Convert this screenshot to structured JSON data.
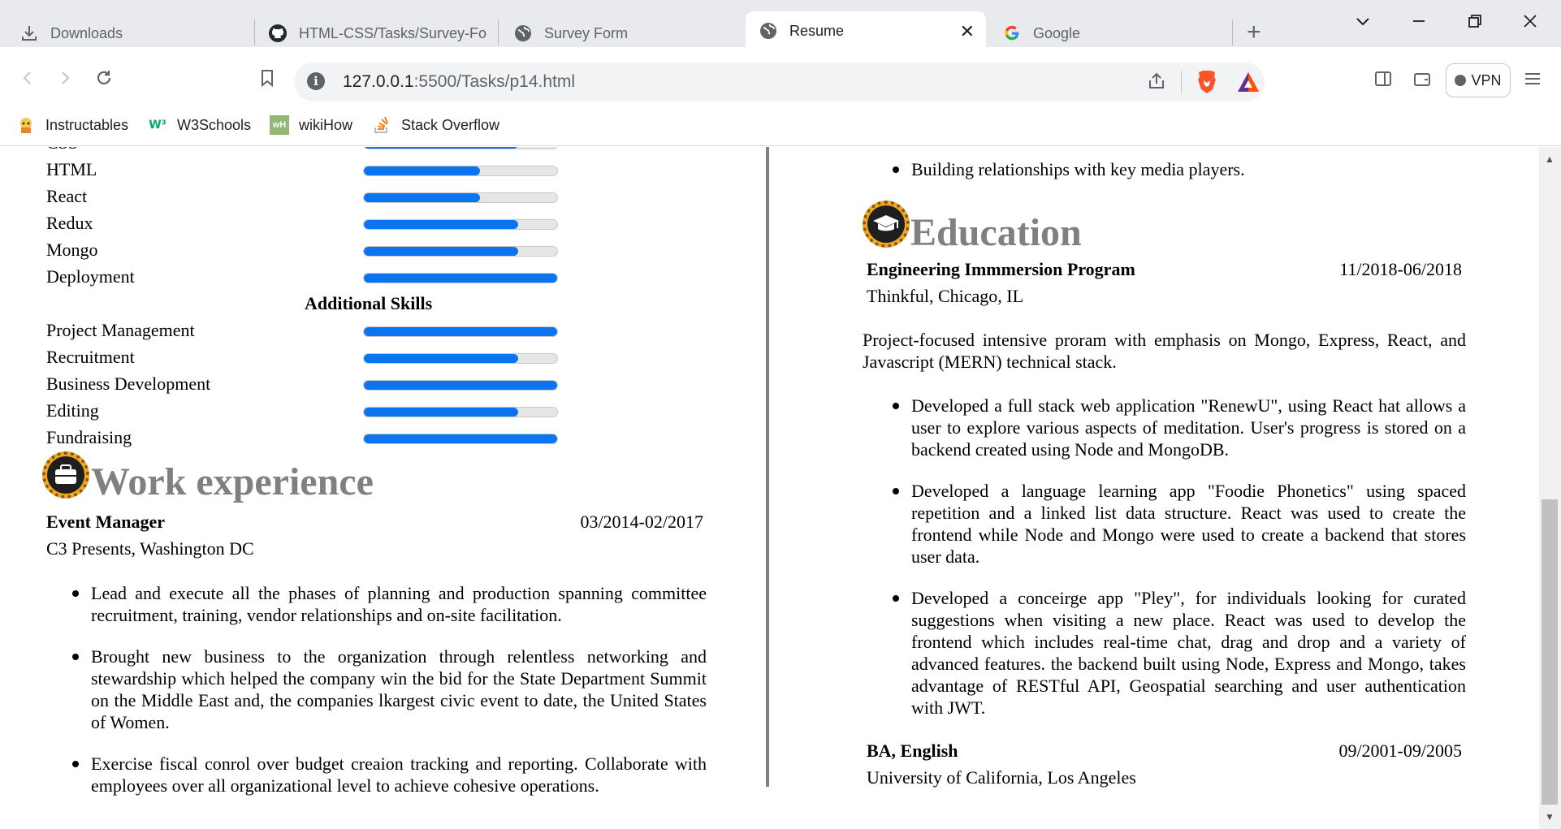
{
  "browser": {
    "tabs": [
      {
        "title": "Downloads",
        "icon": "download-icon"
      },
      {
        "title": "HTML-CSS/Tasks/Survey-Form",
        "icon": "github-icon"
      },
      {
        "title": "Survey Form",
        "icon": "globe-icon"
      },
      {
        "title": "Resume",
        "icon": "globe-icon",
        "active": true
      },
      {
        "title": "Google",
        "icon": "google-icon"
      }
    ],
    "url_host": "127.0.0.1",
    "url_path": ":5500/Tasks/p14.html",
    "vpn_label": "VPN",
    "bookmarks": [
      {
        "label": "Instructables"
      },
      {
        "label": "W3Schools"
      },
      {
        "label": "wikiHow"
      },
      {
        "label": "Stack Overflow"
      }
    ]
  },
  "skills": {
    "partial_top": "CSS",
    "technical": [
      {
        "name": "HTML",
        "level": 0.6
      },
      {
        "name": "React",
        "level": 0.6
      },
      {
        "name": "Redux",
        "level": 0.8
      },
      {
        "name": "Mongo",
        "level": 0.8
      },
      {
        "name": "Deployment",
        "level": 1.0
      }
    ],
    "additional_heading": "Additional Skills",
    "additional": [
      {
        "name": "Project Management",
        "level": 1.0
      },
      {
        "name": "Recruitment",
        "level": 0.8
      },
      {
        "name": "Business Development",
        "level": 1.0
      },
      {
        "name": "Editing",
        "level": 0.8
      },
      {
        "name": "Fundraising",
        "level": 1.0
      }
    ]
  },
  "work": {
    "heading": "Work experience",
    "job_title": "Event Manager",
    "dates": "03/2014-02/2017",
    "place": "C3 Presents, Washington DC",
    "bullets": [
      "Lead and execute all the phases of planning and production spanning committee recruitment, training, vendor relationships and on-site facilitation.",
      "Brought new business to the organization through relentless networking and stewardship which helped the company win the bid for the State Department Summit on the Middle East and, the companies lkargest civic event to date, the United States of Women.",
      "Exercise fiscal conrol over budget creaion tracking and reporting. Collaborate with employees over all organizational level to achieve cohesive operations."
    ]
  },
  "right": {
    "top_bullet": "Building relationships with key media players.",
    "education_heading": "Education",
    "program": {
      "title": "Engineering Immmersion Program",
      "dates": "11/2018-06/2018",
      "place": "Thinkful, Chicago, IL",
      "description": "Project-focused intensive proram with emphasis on Mongo, Express, React, and Javascript (MERN) technical stack.",
      "bullets": [
        "Developed a full stack web application \"RenewU\", using React hat allows a user to explore various aspects of meditation. User's progress is stored on a backend created using Node and MongoDB.",
        "Developed a language learning app \"Foodie Phonetics\" using spaced repetition and a linked list data structure. React was used to create the frontend while Node and Mongo were used to create a backend that stores user data.",
        "Developed a conceirge app \"Pley\", for individuals looking for curated suggestions when visiting a new place. React was used to develop the frontend which includes real-time chat, drag and drop and a variety of advanced features. the backend built using Node, Express and Mongo, takes advantage of RESTful API, Geospatial searching and user authentication with JWT."
      ]
    },
    "degree": {
      "title": "BA, English",
      "dates": "09/2001-09/2005",
      "place": "University of California, Los Angeles"
    }
  },
  "colors": {
    "bar_fill": "#0b74f0",
    "heading_gray": "#808080",
    "badge_orange": "#f5a623"
  }
}
